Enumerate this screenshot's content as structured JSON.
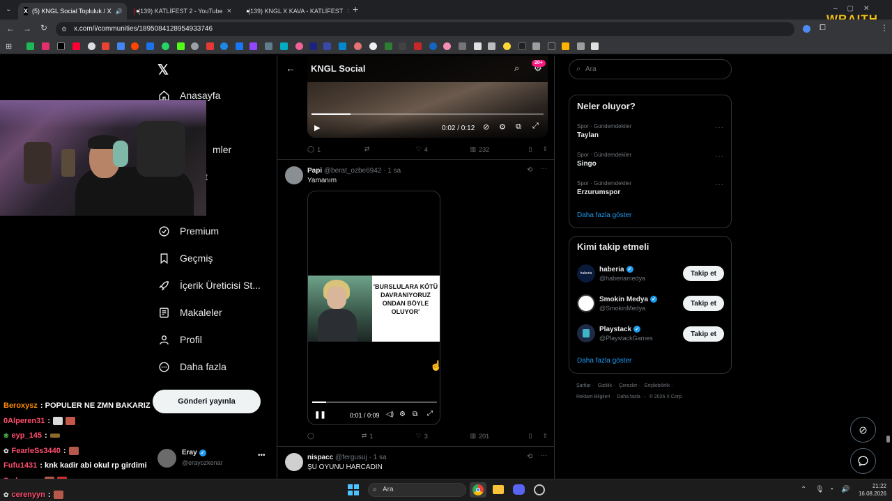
{
  "browser": {
    "tabs": [
      {
        "title": "(5) KNGL Social Topluluk / X",
        "favicon": "x-icon"
      },
      {
        "title": "(139) KATLİFEST 2 - YouTube",
        "favicon": "youtube-icon"
      },
      {
        "title": "(139) KNGL X KAVA - KATLİFEST",
        "favicon": "youtube-icon"
      }
    ],
    "new_tab": "+",
    "url": "x.com/i/communities/1895084128954933746",
    "overlay_brand": "WRAITH"
  },
  "sidebar": {
    "items": [
      {
        "label": "Anasayfa",
        "icon": "home-icon"
      },
      {
        "label": "Premium",
        "icon": "verified-icon"
      },
      {
        "label": "Geçmiş",
        "icon": "bookmark-icon"
      },
      {
        "label": "İçerik Üreticisi St...",
        "icon": "rocket-icon"
      },
      {
        "label": "Makaleler",
        "icon": "article-icon"
      },
      {
        "label": "Profil",
        "icon": "person-icon"
      },
      {
        "label": "Daha fazla",
        "icon": "more-circle-icon"
      }
    ],
    "partial_labels": [
      "mler",
      "t"
    ],
    "post_button": "Gönderi yayınla",
    "account": {
      "name": "Eray",
      "handle": "@erayozkenar"
    }
  },
  "feed": {
    "title": "KNGL Social",
    "notif_badge": "20+",
    "post0": {
      "video_time": "0:02 / 0:12",
      "replies": "1",
      "reposts": "",
      "likes": "4",
      "views": "232"
    },
    "post1": {
      "name": "Papi",
      "handle": "@berat_ozbe6942",
      "time": "· 1 sa",
      "text": "Yamanım",
      "thumb_caption": "'BURSLULARA KÖTÜ DAVRANIYORUZ ONDAN BÖYLE OLUYOR'",
      "video_time": "0:01 / 0:09",
      "replies": "",
      "reposts": "1",
      "likes": "3",
      "views": "201"
    },
    "post2": {
      "name": "nispacc",
      "handle": "@fergusuj",
      "time": "· 1 sa",
      "text": "ŞU OYUNU HARCADIN"
    }
  },
  "right": {
    "search_placeholder": "Ara",
    "trends_title": "Neler oluyor?",
    "trends": [
      {
        "category": "Spor · Gündemdekiler",
        "name": "Taylan"
      },
      {
        "category": "Spor · Gündemdekiler",
        "name": "Singo"
      },
      {
        "category": "Spor · Gündemdekiler",
        "name": "Erzurumspor"
      }
    ],
    "show_more": "Daha fazla göster",
    "who_title": "Kimi takip etmeli",
    "who": [
      {
        "name": "haberia",
        "handle": "@haberiamedya",
        "follow": "Takip et"
      },
      {
        "name": "Smokin Medya",
        "handle": "@SmokinMedya",
        "follow": "Takip et"
      },
      {
        "name": "Playstack",
        "handle": "@PlaystackGames",
        "follow": "Takip et"
      }
    ],
    "show_more2": "Daha fazla göster",
    "footer": {
      "l1": [
        "Şartlar",
        "Gizlilik",
        "Çerezler",
        "Erişilebilirlik"
      ],
      "l2": [
        "Reklam Bilgileri",
        "Daha fazla ···",
        "© 2026 X Corp."
      ]
    }
  },
  "chat": [
    {
      "user": "Beroxysz",
      "msg": ": POPULER NE ZMN BAKARIZ",
      "color": "#ff8a00"
    },
    {
      "user": "0Alperen31",
      "msg": ":",
      "color": "#ff4d6d"
    },
    {
      "user": "eyp_145",
      "msg": ":",
      "color": "#ff4d6d"
    },
    {
      "user": "FearleSs3440",
      "msg": ":",
      "color": "#ff4d6d"
    },
    {
      "user": "Fufu1431",
      "msg": ": knk kadir abi okul rp girdimi",
      "color": "#ff4d6d"
    },
    {
      "user": "Sado_ws",
      "msg": ":",
      "color": "#ff4d6d"
    },
    {
      "user": "cerenyyn",
      "msg": ":",
      "color": "#ff4d6d"
    }
  ],
  "taskbar": {
    "search": "Ara",
    "time": "21:22",
    "date": "16.08.2026"
  }
}
